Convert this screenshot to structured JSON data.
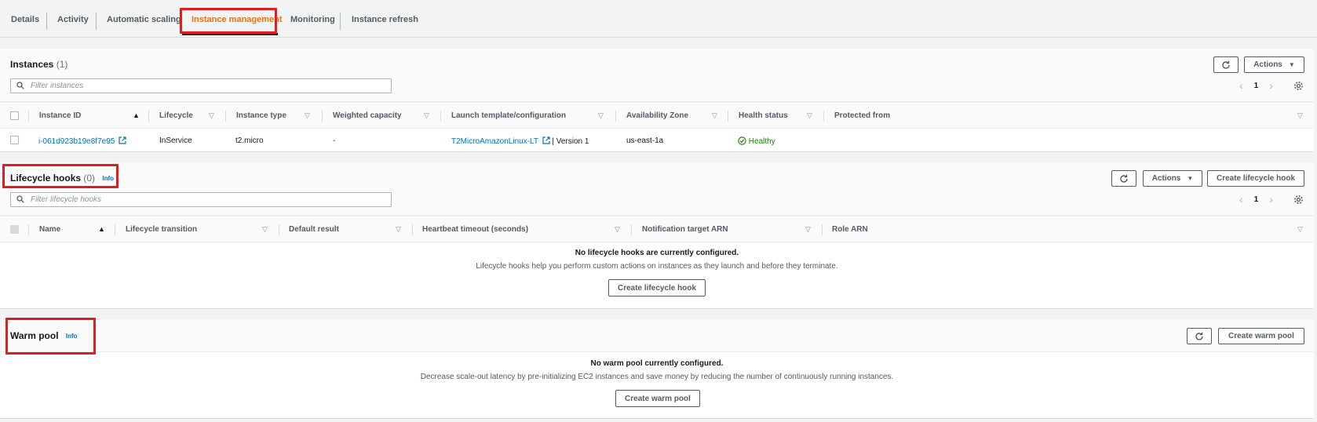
{
  "tabs": [
    {
      "label": "Details"
    },
    {
      "label": "Activity"
    },
    {
      "label": "Automatic scaling"
    },
    {
      "label": "Instance management"
    },
    {
      "label": "Monitoring"
    },
    {
      "label": "Instance refresh"
    }
  ],
  "active_tab": "Instance management",
  "instances": {
    "title": "Instances",
    "count": "(1)",
    "actions_label": "Actions",
    "search_placeholder": "Filter instances",
    "page": "1",
    "columns": [
      "Instance ID",
      "Lifecycle",
      "Instance type",
      "Weighted capacity",
      "Launch template/configuration",
      "Availability Zone",
      "Health status",
      "Protected from"
    ],
    "rows": [
      {
        "instance_id": "i-061d923b19e8f7e95",
        "lifecycle": "InService",
        "instance_type": "t2.micro",
        "weighted_capacity": "-",
        "launch_template": "T2MicroAmazonLinux-LT",
        "launch_version": "| Version 1",
        "availability_zone": "us-east-1a",
        "health_status": "Healthy",
        "protected_from": ""
      }
    ]
  },
  "lifecycle_hooks": {
    "title": "Lifecycle hooks",
    "count": "(0)",
    "info": "Info",
    "actions_label": "Actions",
    "create_label": "Create lifecycle hook",
    "search_placeholder": "Filter lifecycle hooks",
    "page": "1",
    "columns": [
      "Name",
      "Lifecycle transition",
      "Default result",
      "Heartbeat timeout (seconds)",
      "Notification target ARN",
      "Role ARN"
    ],
    "empty_title": "No lifecycle hooks are currently configured.",
    "empty_desc": "Lifecycle hooks help you perform custom actions on instances as they launch and before they terminate.",
    "empty_button": "Create lifecycle hook"
  },
  "warm_pool": {
    "title": "Warm pool",
    "info": "Info",
    "create_label": "Create warm pool",
    "empty_title": "No warm pool currently configured.",
    "empty_desc": "Decrease scale-out latency by pre-initializing EC2 instances and save money by reducing the number of continuously running instances.",
    "empty_button": "Create warm pool"
  },
  "colors": {
    "accent": "#ec7211",
    "link": "#0073bb",
    "success": "#1d8102",
    "highlight": "#e11d22"
  },
  "icons": [
    "refresh-icon",
    "search-icon",
    "settings-icon",
    "external-link-icon",
    "status-ok-icon",
    "caret-down-icon",
    "chevron-left-icon",
    "chevron-right-icon"
  ]
}
